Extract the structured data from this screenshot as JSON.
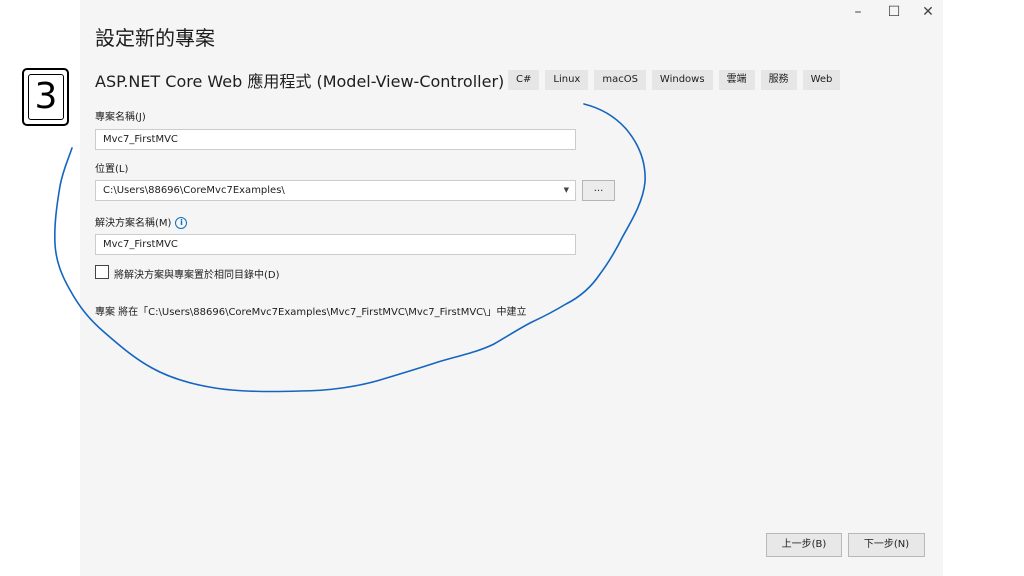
{
  "window_controls": {
    "minimize": "–",
    "maximize": "☐",
    "close": "✕"
  },
  "title": "設定新的專案",
  "template": {
    "name": "ASP.NET Core Web 應用程式 (Model-View-Controller)",
    "tags": [
      "C#",
      "Linux",
      "macOS",
      "Windows",
      "雲端",
      "服務",
      "Web"
    ]
  },
  "form": {
    "project_name_label": "專案名稱(J)",
    "project_name_value": "Mvc7_FirstMVC",
    "location_label": "位置(L)",
    "location_value": "C:\\Users\\88696\\CoreMvc7Examples\\",
    "browse_label": "...",
    "solution_name_label": "解決方案名稱(M)",
    "solution_name_value": "Mvc7_FirstMVC",
    "same_dir_label": "將解決方案與專案置於相同目錄中(D)",
    "same_dir_checked": false,
    "path_note": "專案 將在「C:\\Users\\88696\\CoreMvc7Examples\\Mvc7_FirstMVC\\Mvc7_FirstMVC\\」中建立"
  },
  "footer": {
    "back_label": "上一步(B)",
    "next_label": "下一步(N)"
  },
  "step_badge": "3",
  "annotation_color": "#1565c0"
}
